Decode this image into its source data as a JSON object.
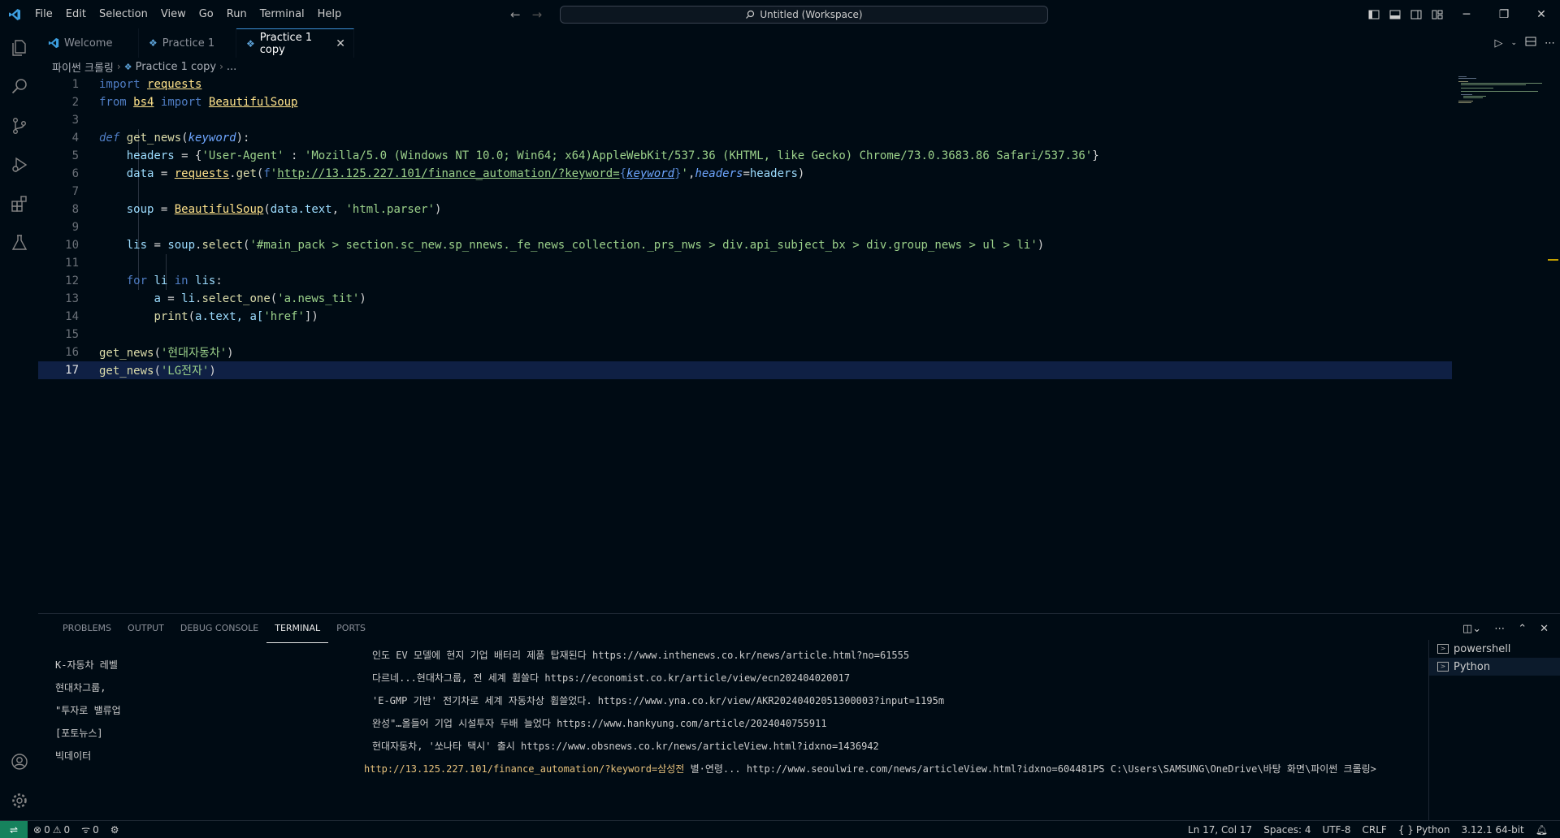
{
  "menu": [
    "File",
    "Edit",
    "Selection",
    "View",
    "Go",
    "Run",
    "Terminal",
    "Help"
  ],
  "command_center": {
    "label": "Untitled (Workspace)"
  },
  "tabs": [
    {
      "label": "Welcome",
      "icon": "vscode-logo-icon"
    },
    {
      "label": "Practice 1",
      "icon": "python-icon"
    },
    {
      "label": "Practice 1 copy",
      "icon": "python-icon",
      "active": true
    }
  ],
  "breadcrumb": {
    "folder": "파이썬 크롤링",
    "file": "Practice 1 copy",
    "more": "..."
  },
  "code": {
    "line_numbers": [
      "1",
      "2",
      "3",
      "4",
      "5",
      "6",
      "7",
      "8",
      "9",
      "10",
      "11",
      "12",
      "13",
      "14",
      "15",
      "16",
      "17"
    ],
    "l1": {
      "kw": "import",
      "mod": "requests"
    },
    "l2": {
      "kw1": "from",
      "mod": "bs4",
      "kw2": "import",
      "cls": "BeautifulSoup"
    },
    "l4": {
      "kw": "def",
      "fn": "get_news",
      "param": "keyword",
      "rest": "):"
    },
    "l5": {
      "var": "headers",
      "eq": " = {",
      "key": "'User-Agent'",
      "colon": " : ",
      "val": "'Mozilla/5.0 (Windows NT 10.0; Win64; x64)AppleWebKit/537.36 (KHTML, like Gecko) Chrome/73.0.3683.86 Safari/537.36'",
      "close": "}"
    },
    "l6": {
      "var": "data",
      "eq": " = ",
      "mod": "requests",
      "dot": ".",
      "fn": "get",
      "open": "(",
      "f": "f",
      "q1": "'",
      "url": "http://13.125.227.101/finance_automation/?keyword=",
      "lb": "{",
      "param": "keyword",
      "rb": "}",
      "q2": "'",
      "comma": ",",
      "kwarg": "headers",
      "eq2": "=",
      "arg": "headers",
      "close": ")"
    },
    "l8": {
      "var": "soup",
      "eq": " = ",
      "cls": "BeautifulSoup",
      "open": "(",
      "arg": "data.text",
      "comma": ", ",
      "str": "'html.parser'",
      "close": ")"
    },
    "l10": {
      "var": "lis",
      "eq": " = ",
      "obj": "soup",
      "dot": ".",
      "fn": "select",
      "open": "(",
      "str": "'#main_pack > section.sc_new.sp_nnews._fe_news_collection._prs_nws > div.api_subject_bx > div.group_news > ul > li'",
      "close": ")"
    },
    "l12": {
      "kw": "for",
      "var": "li",
      "kw2": "in",
      "var2": "lis",
      "colon": ":"
    },
    "l13": {
      "var": "a",
      "eq": " = ",
      "obj": "li",
      "dot": ".",
      "fn": "select_one",
      "open": "(",
      "str": "'a.news_tit'",
      "close": ")"
    },
    "l14": {
      "fn": "print",
      "open": "(",
      "arg": "a.text, a[",
      "str": "'href'",
      "close": "])"
    },
    "l16": {
      "fn": "get_news",
      "open": "(",
      "str": "'현대자동차'",
      "close": ")"
    },
    "l17": {
      "fn": "get_news",
      "open": "(",
      "str": "'LG전자'",
      "close": ")"
    }
  },
  "panel": {
    "tabs": [
      "PROBLEMS",
      "OUTPUT",
      "DEBUG CONSOLE",
      "TERMINAL",
      "PORTS"
    ],
    "active_tab": "TERMINAL"
  },
  "terminal": {
    "left_lines": [
      "K-자동차 레벨",
      "현대차그룹,",
      "\"투자로 밸류업",
      "[포토뉴스]",
      "빅데이터"
    ],
    "right_lines": [
      "인도 EV 모델에 현지 기업 배터리 제품 탑재된다 https://www.inthenews.co.kr/news/article.html?no=61555",
      "다르네...현대차그룹, 전 세계 휩쓸다 https://economist.co.kr/article/view/ecn202404020017",
      "'E-GMP 기반' 전기차로 세계 자동차상 휩쓸었다. https://www.yna.co.kr/view/AKR20240402051300003?input=1195m",
      "완성\"…올들어 기업 시설투자 두배 늘었다 https://www.hankyung.com/article/2024040755911",
      "현대자동차, '쏘나타 택시' 출시 https://www.obsnews.co.kr/news/articleView.html?idxno=1436942"
    ],
    "last_line_url": "http://13.125.227.101/finance_automation/?keyword=삼성전",
    "last_line_rest": " 별·연령... http://www.seoulwire.com/news/articleView.html?idxno=604481PS C:\\Users\\SAMSUNG\\OneDrive\\바탕 화면\\파이썬 크롤링>",
    "instances": [
      "powershell",
      "Python"
    ]
  },
  "statusbar": {
    "errors": "0",
    "warnings": "0",
    "ports": "0",
    "position": "Ln 17, Col 17",
    "spaces": "Spaces: 4",
    "encoding": "UTF-8",
    "eol": "CRLF",
    "language": "Python",
    "interpreter": "3.12.1 64-bit"
  },
  "colors": {
    "background": "#000b14",
    "accent": "#3d8fd6",
    "current_line": "#0f2044",
    "remote": "#16825d"
  }
}
